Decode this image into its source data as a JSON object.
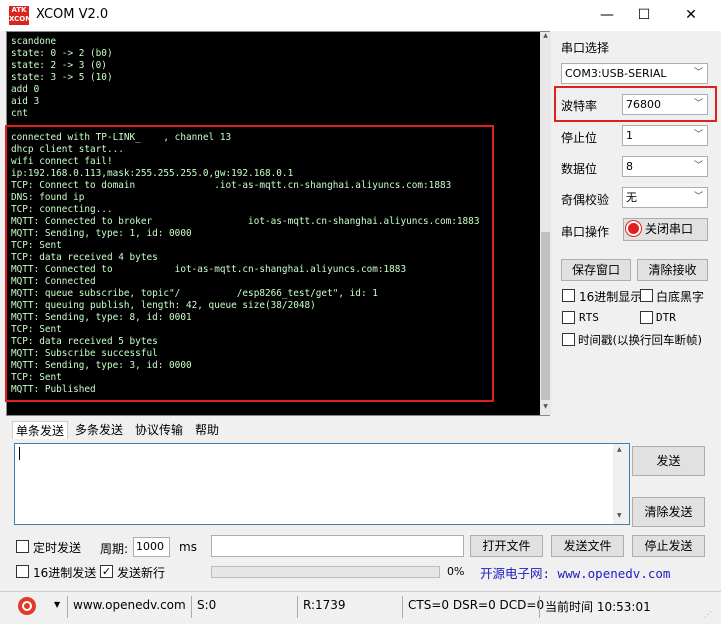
{
  "window": {
    "title": "XCOM V2.0",
    "logo_text": "ATK XCOM",
    "min_glyph": "—",
    "max_glyph": "☐",
    "close_glyph": "✕"
  },
  "terminal": {
    "lines": [
      "scandone",
      "state: 0 -> 2 (b0)",
      "state: 2 -> 3 (0)",
      "state: 3 -> 5 (10)",
      "add 0",
      "aid 3",
      "cnt",
      "",
      "connected with TP-LINK_    , channel 13",
      "dhcp client start...",
      "wifi connect fail!",
      "ip:192.168.0.113,mask:255.255.255.0,gw:192.168.0.1",
      "TCP: Connect to domain              .iot-as-mqtt.cn-shanghai.aliyuncs.com:1883",
      "DNS: found ip",
      "TCP: connecting...",
      "MQTT: Connected to broker                 iot-as-mqtt.cn-shanghai.aliyuncs.com:1883",
      "MQTT: Sending, type: 1, id: 0000",
      "TCP: Sent",
      "TCP: data received 4 bytes",
      "MQTT: Connected to           iot-as-mqtt.cn-shanghai.aliyuncs.com:1883",
      "MQTT: Connected",
      "MQTT: queue subscribe, topic\"/          /esp8266_test/get\", id: 1",
      "MQTT: queuing publish, length: 42, queue size(38/2048)",
      "MQTT: Sending, type: 8, id: 0001",
      "TCP: Sent",
      "TCP: data received 5 bytes",
      "MQTT: Subscribe successful",
      "MQTT: Sending, type: 3, id: 0000",
      "TCP: Sent",
      "MQTT: Published"
    ]
  },
  "settings": {
    "port_label": "串口选择",
    "port_value": "COM3:USB-SERIAL",
    "baud_label": "波特率",
    "baud_value": "76800",
    "stopbits_label": "停止位",
    "stopbits_value": "1",
    "databits_label": "数据位",
    "databits_value": "8",
    "parity_label": "奇偶校验",
    "parity_value": "无",
    "operation_label": "串口操作",
    "close_port_button": "关闭串口",
    "save_window_button": "保存窗口",
    "clear_receive_button": "清除接收",
    "hex_display_label": "16进制显示",
    "white_bg_label": "白底黑字",
    "rts_label": "RTS",
    "dtr_label": "DTR",
    "timestamp_label": "时间戳(以换行回车断帧)"
  },
  "tabs": [
    "单条发送",
    "多条发送",
    "协议传输",
    "帮助"
  ],
  "send": {
    "send_button": "发送",
    "clear_send_button": "清除发送",
    "timed_send_label": "定时发送",
    "period_label": "周期:",
    "period_value": "1000",
    "period_unit": "ms",
    "open_file_button": "打开文件",
    "send_file_button": "发送文件",
    "stop_send_button": "停止发送",
    "hex_send_label": "16进制发送",
    "newline_label": "发送新行",
    "progress_text": "0%",
    "progress_value": 0,
    "website_banner": "开源电子网: www.openedv.com"
  },
  "statusbar": {
    "website": "www.openedv.com",
    "sent": "S:0",
    "received": "R:1739",
    "signals": "CTS=0 DSR=0 DCD=0",
    "time": "当前时间 10:53:01"
  },
  "colors": {
    "terminal_bg": "#000000",
    "terminal_fg": "#c8ffc8",
    "highlight_red": "#e02020",
    "banner_blue": "#2020c0"
  }
}
